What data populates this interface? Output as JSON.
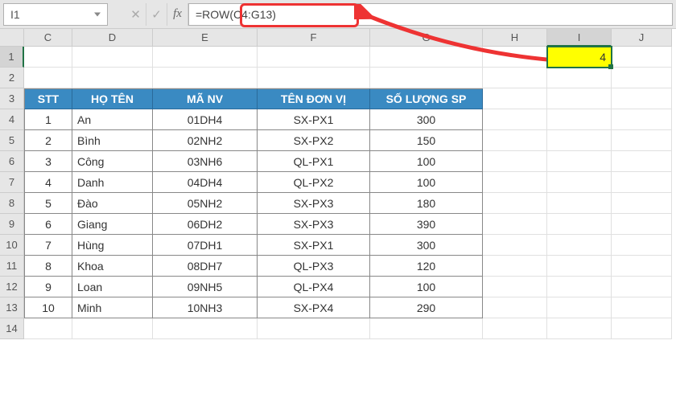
{
  "formula_bar": {
    "name_box": "I1",
    "cancel": "✕",
    "confirm": "✓",
    "fx": "fx",
    "formula": "=ROW(C4:G13)"
  },
  "columns": [
    "C",
    "D",
    "E",
    "F",
    "G",
    "H",
    "I",
    "J"
  ],
  "col_widths": [
    "wC",
    "wD",
    "wE",
    "wF",
    "wG",
    "wH",
    "wI",
    "wJ"
  ],
  "active_cell": {
    "row": 1,
    "col": "I",
    "value": "4"
  },
  "table": {
    "headers": [
      "STT",
      "HỌ TÊN",
      "MÃ NV",
      "TÊN ĐƠN VỊ",
      "SỐ LƯỢNG SP"
    ],
    "rows": [
      {
        "stt": "1",
        "ho_ten": "An",
        "ma_nv": "01DH4",
        "ten_dv": "SX-PX1",
        "sl": "300"
      },
      {
        "stt": "2",
        "ho_ten": "Bình",
        "ma_nv": "02NH2",
        "ten_dv": "SX-PX2",
        "sl": "150"
      },
      {
        "stt": "3",
        "ho_ten": "Công",
        "ma_nv": "03NH6",
        "ten_dv": "QL-PX1",
        "sl": "100"
      },
      {
        "stt": "4",
        "ho_ten": "Danh",
        "ma_nv": "04DH4",
        "ten_dv": "QL-PX2",
        "sl": "100"
      },
      {
        "stt": "5",
        "ho_ten": "Đào",
        "ma_nv": "05NH2",
        "ten_dv": "SX-PX3",
        "sl": "180"
      },
      {
        "stt": "6",
        "ho_ten": "Giang",
        "ma_nv": "06DH2",
        "ten_dv": "SX-PX3",
        "sl": "390"
      },
      {
        "stt": "7",
        "ho_ten": "Hùng",
        "ma_nv": "07DH1",
        "ten_dv": "SX-PX1",
        "sl": "300"
      },
      {
        "stt": "8",
        "ho_ten": "Khoa",
        "ma_nv": "08DH7",
        "ten_dv": "QL-PX3",
        "sl": "120"
      },
      {
        "stt": "9",
        "ho_ten": "Loan",
        "ma_nv": "09NH5",
        "ten_dv": "QL-PX4",
        "sl": "100"
      },
      {
        "stt": "10",
        "ho_ten": "Minh",
        "ma_nv": "10NH3",
        "ten_dv": "SX-PX4",
        "sl": "290"
      }
    ]
  },
  "row_numbers": [
    1,
    2,
    3,
    4,
    5,
    6,
    7,
    8,
    9,
    10,
    11,
    12,
    13,
    14
  ]
}
